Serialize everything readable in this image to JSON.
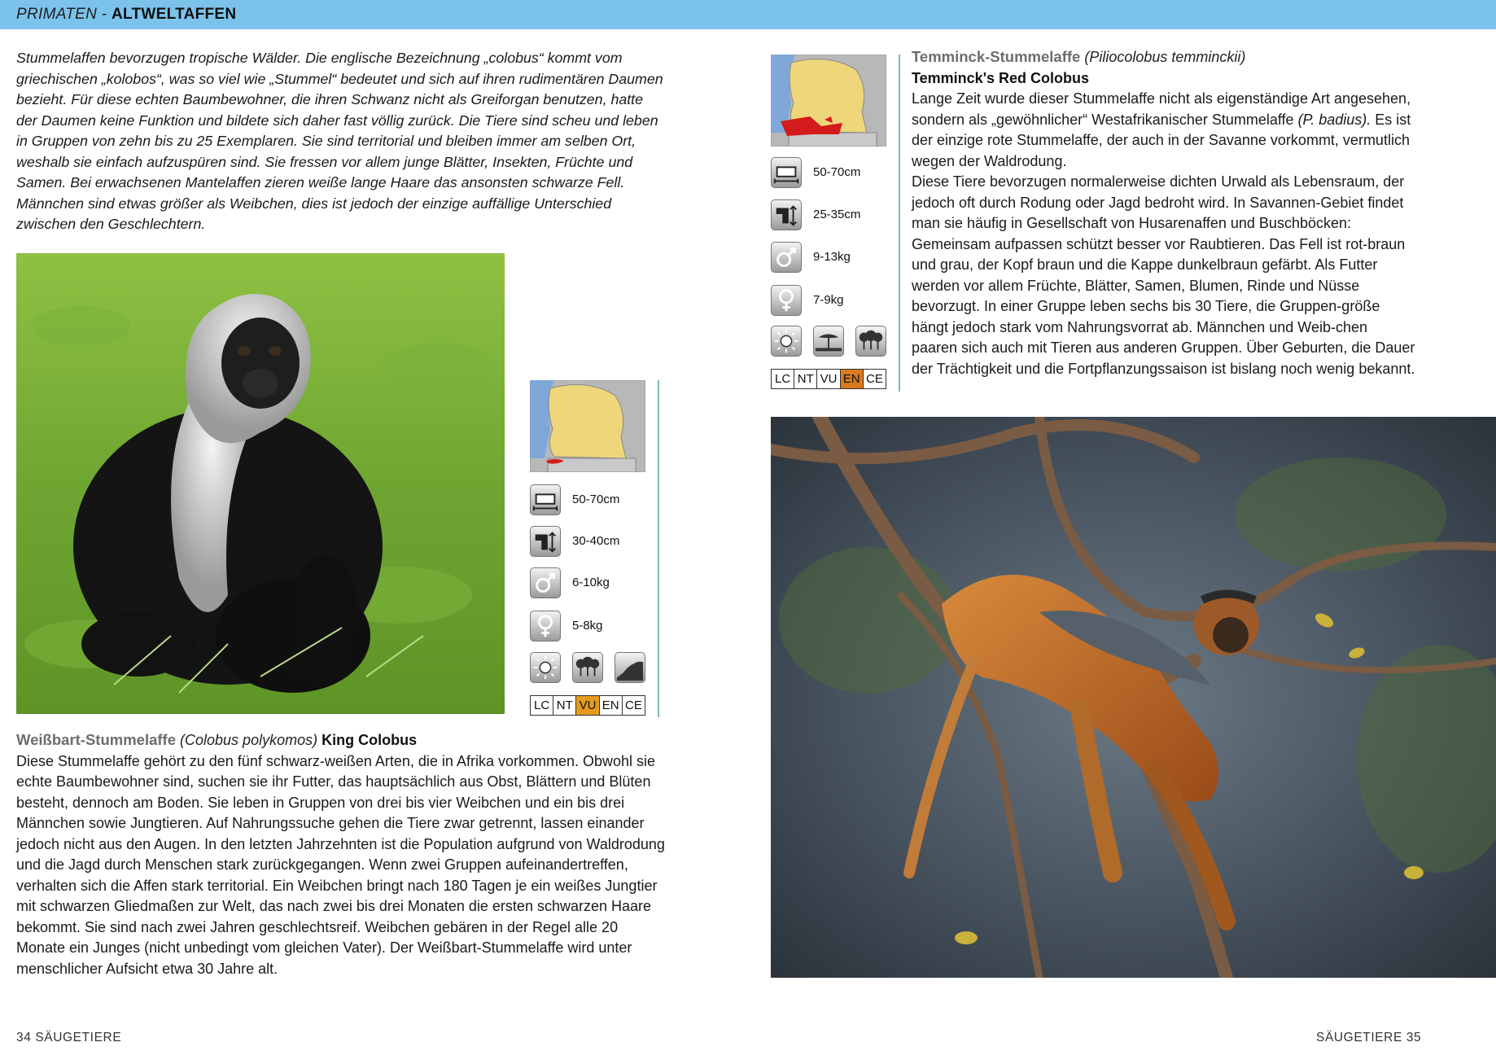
{
  "header": {
    "section": "PRIMATEN -",
    "title": "ALTWELTAFFEN",
    "color": "#7cc3ec"
  },
  "intro": "Stummelaffen bevorzugen tropische Wälder. Die englische Bezeichnung „colobus“ kommt vom griechischen „kolobos“, was so viel wie „Stummel“ bedeutet und sich auf ihren rudimentären Daumen bezieht. Für diese echten Baumbewohner, die ihren Schwanz nicht als Greiforgan benutzen, hatte der Daumen keine Funktion und bildete sich daher fast völlig zurück. Die Tiere sind scheu und leben in Gruppen von zehn bis zu 25 Exemplaren. Sie sind territorial und bleiben immer am selben Ort, weshalb sie einfach aufzuspüren sind. Sie fressen vor allem junge Blätter, Insekten, Früchte und Samen. Bei erwachsenen Mantelaffen zieren weiße lange Haare das ansonsten schwarze Fell. Männchen sind etwas größer als Weibchen, dies ist jedoch der einzige auffällige Unterschied zwischen den Geschlechtern.",
  "species_left": {
    "name": "Weißbart-Stummelaffe",
    "latin": "(Colobus polykomos)",
    "english": "King Colobus",
    "body_length": "50-70cm",
    "tail_length": "30-40cm",
    "male_weight": "6-10kg",
    "female_weight": "5-8kg",
    "iucn": [
      "LC",
      "NT",
      "VU",
      "EN",
      "CE"
    ],
    "iucn_status": "VU",
    "habitat_icons": [
      "sun-icon",
      "forest-icon",
      "hill-icon"
    ],
    "text": "Diese Stummelaffe gehört zu den fünf schwarz-weißen Arten, die in Afrika vorkommen. Obwohl sie echte Baumbewohner sind, suchen sie ihr Futter, das hauptsächlich aus Obst, Blättern und Blüten besteht, dennoch am Boden. Sie leben in Gruppen von drei bis vier Weibchen und ein bis drei Männchen sowie Jungtieren. Auf Nahrungssuche gehen die Tiere zwar getrennt, lassen einander jedoch nicht aus den Augen. In den letzten Jahrzehnten ist die Population aufgrund von Waldrodung und die Jagd durch Menschen stark zurückgegangen. Wenn zwei Gruppen aufeinandertreffen, verhalten sich die Affen stark territorial. Ein Weibchen bringt nach 180 Tagen je ein weißes Jungtier mit schwarzen Gliedmaßen zur Welt, das nach zwei bis drei Monaten die ersten schwarzen Haare bekommt. Sie sind nach zwei Jahren geschlechtsreif. Weibchen gebären in der Regel alle 20 Monate ein Junges (nicht unbedingt vom gleichen Vater). Der Weißbart-Stummelaffe wird unter menschlicher Aufsicht etwa 30 Jahre alt."
  },
  "species_right": {
    "name": "Temminck-Stummelaffe",
    "latin": "(Piliocolobus temminckii)",
    "english": "Temminck's Red Colobus",
    "body_length": "50-70cm",
    "tail_length": "25-35cm",
    "male_weight": "9-13kg",
    "female_weight": "7-9kg",
    "iucn": [
      "LC",
      "NT",
      "VU",
      "EN",
      "CE"
    ],
    "iucn_status": "EN",
    "habitat_icons": [
      "sun-icon",
      "savanna-tree-icon",
      "forest-icon"
    ],
    "text_1": "Lange Zeit wurde dieser Stummelaffe nicht als eigenständige Art angesehen, sondern als „gewöhnlicher“ Westafrikanischer Stummelaffe",
    "text_italic": "(P. badius).",
    "text_2": "Es ist der einzige rote Stummelaffe, der auch in der Savanne vorkommt, vermutlich wegen der Waldrodung.",
    "text_3": "Diese Tiere bevorzugen normalerweise dichten Urwald als Lebensraum, der jedoch oft durch Rodung oder Jagd bedroht wird. In Savannen-Gebiet findet man sie häufig in Gesellschaft von Husarenaffen und Buschböcken: Gemeinsam aufpassen schützt besser vor Raubtieren. Das Fell ist rot-braun und grau, der Kopf braun und die Kappe dunkelbraun gefärbt. Als Futter werden vor allem Früchte, Blätter, Samen, Blumen, Rinde und Nüsse bevorzugt. In einer Gruppe leben sechs bis 30 Tiere, die Gruppen-größe hängt jedoch stark vom Nahrungsvorrat ab. Männchen und Weib-chen paaren sich auch mit Tieren aus anderen Gruppen. Über Geburten, die Dauer der Trächtigkeit und die Fortpflanzungssaison ist bislang noch wenig bekannt."
  },
  "footer": {
    "left": "34 SÄUGETIERE",
    "right": "SÄUGETIERE 35"
  },
  "colors": {
    "iucn_vu": "#e59b1e",
    "iucn_en": "#dc7a1b",
    "map_land": "#efd67a",
    "map_range": "#d41b1b",
    "rule": "#7bbfa8"
  }
}
